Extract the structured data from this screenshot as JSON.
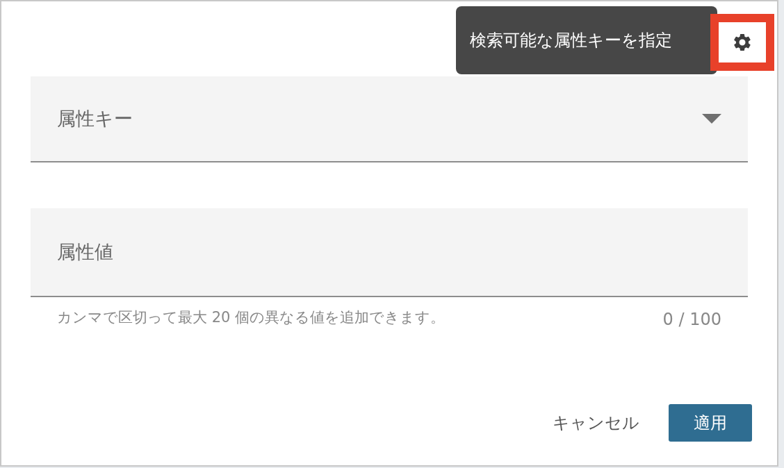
{
  "tooltip": {
    "text": "検索可能な属性キーを指定"
  },
  "settings_button": {
    "highlighted": true
  },
  "key_select": {
    "label": "属性キー"
  },
  "value_field": {
    "placeholder": "属性値",
    "helper": "カンマで区切って最大 20 個の異なる値を追加できます。",
    "counter": "0 / 100"
  },
  "buttons": [
    {
      "label": "キャンセル",
      "kind": "text"
    },
    {
      "label": "適用",
      "kind": "primary"
    }
  ]
}
